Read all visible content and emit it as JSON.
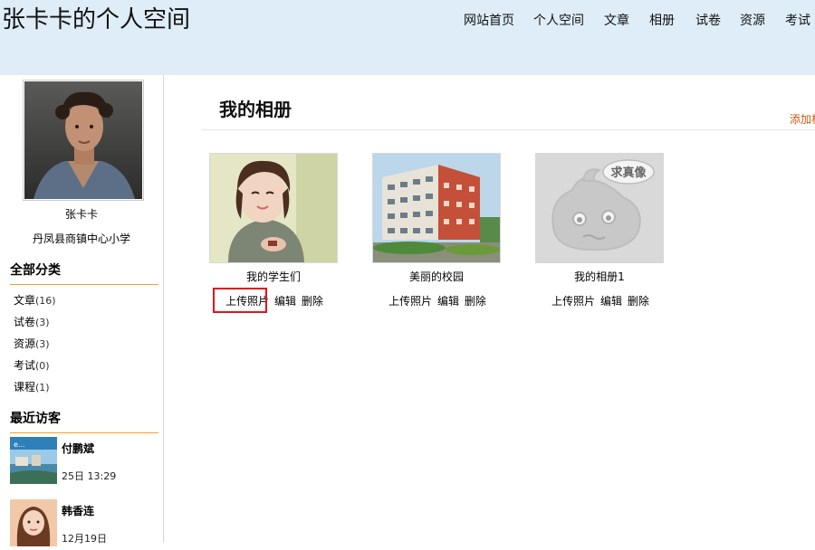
{
  "header": {
    "site_title": "张卡卡的个人空间",
    "nav": [
      "网站首页",
      "个人空间",
      "文章",
      "相册",
      "试卷",
      "资源",
      "考试"
    ]
  },
  "sidebar": {
    "user_name": "张卡卡",
    "school": "丹凤县商镇中心小学",
    "categories_title": "全部分类",
    "categories": [
      {
        "label": "文章",
        "count": "(16)"
      },
      {
        "label": "试卷",
        "count": "(3)"
      },
      {
        "label": "资源",
        "count": "(3)"
      },
      {
        "label": "考试",
        "count": "(0)"
      },
      {
        "label": "课程",
        "count": "(1)"
      }
    ],
    "visitors_title": "最近访客",
    "visitors": [
      {
        "name": "付鹏斌",
        "time": "25日 13:29"
      },
      {
        "name": "韩香连",
        "time": "12月19日"
      }
    ]
  },
  "main": {
    "title": "我的相册",
    "add_link": "添加相",
    "albums": [
      {
        "name": "我的学生们",
        "upload": "上传照片",
        "edit": "编辑",
        "delete": "删除"
      },
      {
        "name": "美丽的校园",
        "upload": "上传照片",
        "edit": "编辑",
        "delete": "删除"
      },
      {
        "name": "我的相册1",
        "upload": "上传照片",
        "edit": "编辑",
        "delete": "删除",
        "cover_text": "求真像"
      }
    ]
  },
  "colors": {
    "header_bg": "#deedf7",
    "section_rule": "#f0a030",
    "add_link": "#c85a14",
    "highlight": "#e0141c"
  }
}
